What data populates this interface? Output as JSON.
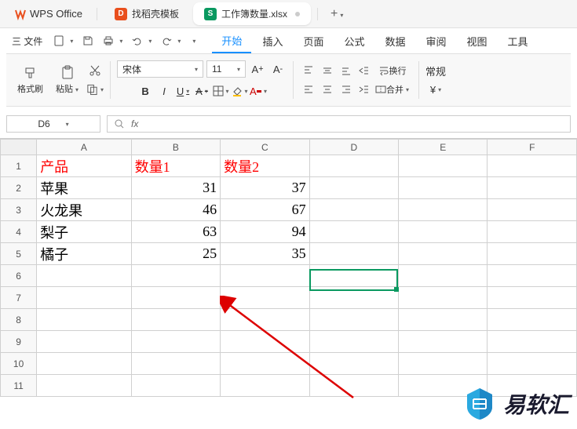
{
  "titlebar": {
    "apptitle": "WPS Office",
    "tab_template": "找稻壳模板",
    "tab_file": "工作簿数量.xlsx",
    "tab_template_initial": "D",
    "tab_file_initial": "S"
  },
  "menus": {
    "file": "三 文件",
    "items": [
      "开始",
      "插入",
      "页面",
      "公式",
      "数据",
      "审阅",
      "视图",
      "工具"
    ]
  },
  "ribbon": {
    "format_brush": "格式刷",
    "paste": "粘贴",
    "font_name": "宋体",
    "font_size": "11",
    "wrap": "换行",
    "merge": "合并",
    "normal": "常规",
    "bold": "B",
    "italic": "I",
    "underline": "U",
    "strike": "A"
  },
  "formula_bar": {
    "cell_ref": "D6",
    "fx": "fx"
  },
  "columns": [
    "A",
    "B",
    "C",
    "D",
    "E",
    "F"
  ],
  "rows": [
    "1",
    "2",
    "3",
    "4",
    "5",
    "6",
    "7",
    "8",
    "9",
    "10",
    "11"
  ],
  "chart_data": {
    "type": "table",
    "headers": [
      "产品",
      "数量1",
      "数量2"
    ],
    "rows": [
      {
        "product": "苹果",
        "qty1": 31,
        "qty2": 37
      },
      {
        "product": "火龙果",
        "qty1": 46,
        "qty2": 67
      },
      {
        "product": "梨子",
        "qty1": 63,
        "qty2": 94
      },
      {
        "product": "橘子",
        "qty1": 25,
        "qty2": 35
      }
    ]
  },
  "watermark": "易软汇"
}
